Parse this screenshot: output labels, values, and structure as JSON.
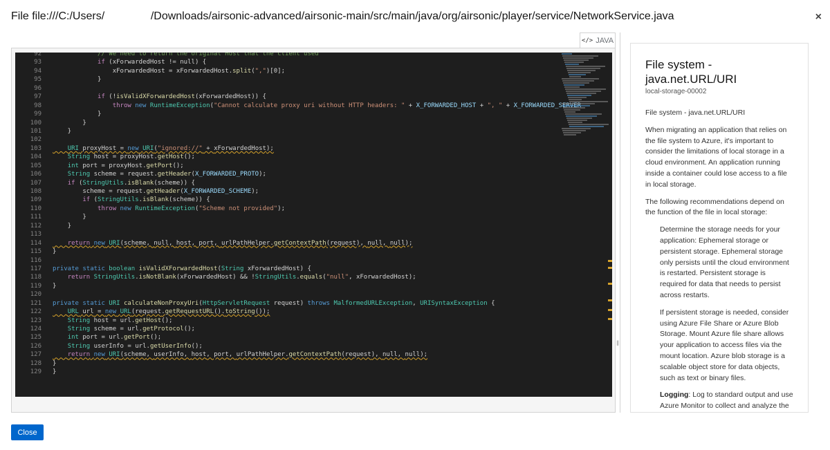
{
  "modal": {
    "title": "File file:///C:/Users/               /Downloads/airsonic-advanced/airsonic-main/src/main/java/org/airsonic/player/service/NetworkService.java",
    "close_icon": "×",
    "close_button": "Close"
  },
  "editor": {
    "language_label": "JAVA",
    "language_icon": "code-icon"
  },
  "code_lines": [
    "92|            // We need to return the original Host that the client used",
    "93|            if (xForwardedHost != null) {",
    "94|                xForwardedHost = xForwardedHost.split(\",\")[0];",
    "95|            }",
    "96|",
    "97|            if (!isValidXForwardedHost(xForwardedHost)) {",
    "98|                throw new RuntimeException(\"Cannot calculate proxy uri without HTTP headers: \" + X_FORWARDED_HOST + \", \" + X_FORWARDED_SERVER",
    "99|            }",
    "100|        }",
    "101|    }",
    "102|",
    "103|    URI proxyHost = new URI(\"ignored://\" + xForwardedHost);",
    "104|    String host = proxyHost.getHost();",
    "105|    int port = proxyHost.getPort();",
    "106|    String scheme = request.getHeader(X_FORWARDED_PROTO);",
    "107|    if (StringUtils.isBlank(scheme)) {",
    "108|        scheme = request.getHeader(X_FORWARDED_SCHEME);",
    "109|        if (StringUtils.isBlank(scheme)) {",
    "110|            throw new RuntimeException(\"Scheme not provided\");",
    "111|        }",
    "112|    }",
    "113|",
    "114|    return new URI(scheme, null, host, port, urlPathHelper.getContextPath(request), null, null);",
    "115|}",
    "116|",
    "117|private static boolean isValidXForwardedHost(String xForwardedHost) {",
    "118|    return StringUtils.isNotBlank(xForwardedHost) && !StringUtils.equals(\"null\", xForwardedHost);",
    "119|}",
    "120|",
    "121|private static URI calculateNonProxyUri(HttpServletRequest request) throws MalformedURLException, URISyntaxException {",
    "122|    URL url = new URL(request.getRequestURL().toString());",
    "123|    String host = url.getHost();",
    "124|    String scheme = url.getProtocol();",
    "125|    int port = url.getPort();",
    "126|    String userInfo = url.getUserInfo();",
    "127|    return new URI(scheme, userInfo, host, port, urlPathHelper.getContextPath(request), null, null);",
    "128|}",
    "129|}"
  ],
  "side_panel": {
    "title": "File system - java.net.URL/URI",
    "rule_id": "local-storage-00002",
    "paragraphs": [
      "File system - java.net.URL/URI",
      "When migrating an application that relies on the file system to Azure, it's important to consider the limitations of local storage in a cloud environment. An application running inside a container could lose access to a file in local storage.",
      "The following recommendations depend on the function of the file in local storage:"
    ],
    "indented": [
      "Determine the storage needs for your application: Ephemeral storage or persistent storage. Ephemeral storage only persists until the cloud environment is restarted. Persistent storage is required for data that needs to persist across restarts.",
      "If persistent storage is needed, consider using Azure File Share or Azure Blob Storage. Mount Azure file share allows your application to access files via the mount location. Azure blob storage is a scalable object store for data objects, such as text or binary files."
    ],
    "logging_label": "Logging",
    "logging_text": ": Log to standard output and use Azure Monitor to collect and analyze the"
  },
  "colors": {
    "accent": "#0066cc",
    "editor_bg": "#1e1e1e",
    "warning_squiggle": "#d7a32b"
  }
}
